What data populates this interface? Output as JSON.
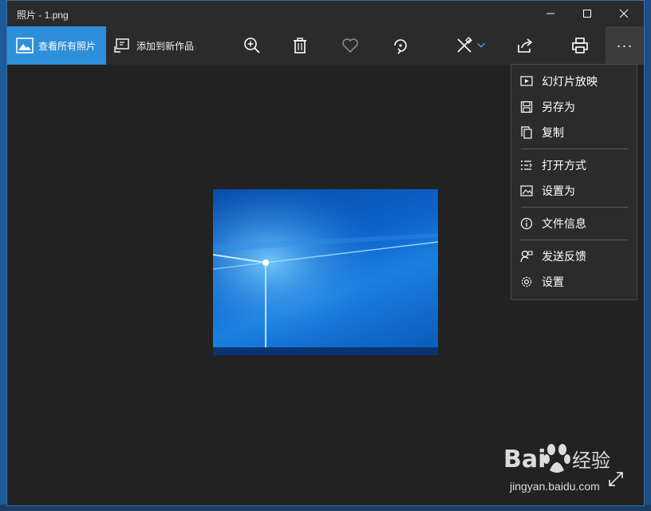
{
  "window": {
    "title": "照片 - 1.png",
    "controls": [
      "minimize",
      "maximize",
      "close"
    ]
  },
  "toolbar": {
    "view_all_label": "查看所有照片",
    "add_to_creation_label": "添加到新作品",
    "icons": [
      "zoom-in-icon",
      "delete-icon",
      "favorite-icon",
      "rotate-icon",
      "edit-icon",
      "share-icon",
      "print-icon"
    ],
    "more_label": "···"
  },
  "menu": {
    "items": [
      {
        "label": "幻灯片放映",
        "icon": "slideshow-icon"
      },
      {
        "label": "另存为",
        "icon": "save-icon"
      },
      {
        "label": "复制",
        "icon": "copy-icon"
      },
      {
        "label": "打开方式",
        "icon": "open-with-icon"
      },
      {
        "label": "设置为",
        "icon": "set-as-icon"
      },
      {
        "label": "文件信息",
        "icon": "info-icon"
      },
      {
        "label": "发送反馈",
        "icon": "feedback-icon"
      },
      {
        "label": "设置",
        "icon": "settings-icon"
      }
    ]
  },
  "watermark": {
    "logo_text": "Bai 经验",
    "url": "jingyan.baidu.com"
  },
  "colors": {
    "accent": "#2d8fd9",
    "background": "#222222",
    "toolbar": "#2b2b2b"
  }
}
